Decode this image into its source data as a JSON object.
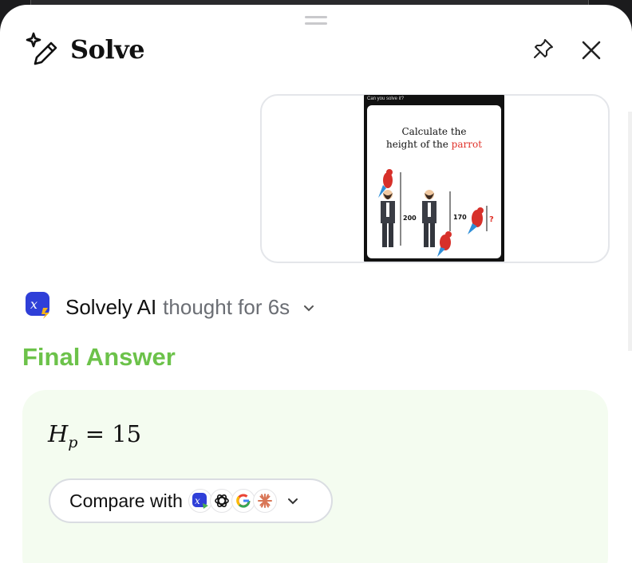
{
  "header": {
    "title": "Solve"
  },
  "image_card": {
    "corner_text": "Can you solve it?",
    "question_line1": "Calculate the",
    "question_line2_prefix": "height of the ",
    "question_line2_highlight": "parrot",
    "label_left": "200",
    "label_right": "170",
    "label_unknown": "?"
  },
  "thought": {
    "app_name": "Solvely AI",
    "status": "thought for 6s"
  },
  "final_answer": {
    "heading": "Final Answer",
    "math_var": "H",
    "math_sub": "p",
    "math_rest": "= 15"
  },
  "compare": {
    "label": "Compare with"
  },
  "icons": [
    "sparkle-pen-icon",
    "pin-icon",
    "close-icon",
    "solvely-logo-icon",
    "chevron-down-icon",
    "chatgpt-logo-icon",
    "google-logo-icon",
    "claude-logo-icon"
  ],
  "colors": {
    "accent_green": "#6cc24a",
    "answer_bg": "#f4fcf0",
    "solvely_blue": "#2f3fd8",
    "parrot_red": "#e0322a"
  }
}
